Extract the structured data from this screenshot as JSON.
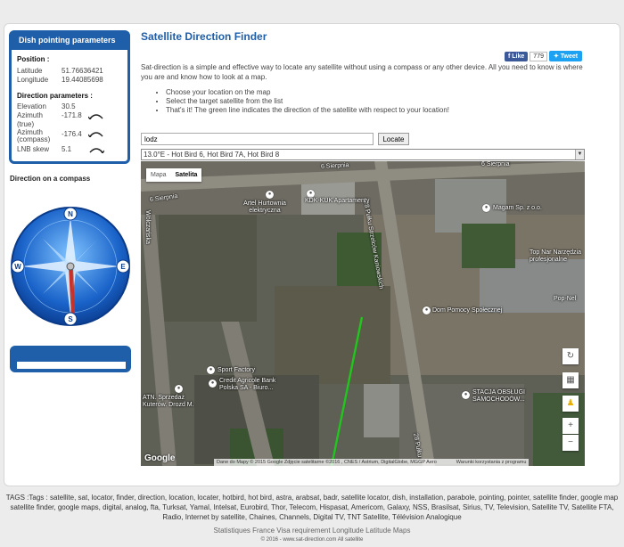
{
  "sidebar": {
    "panel_title": "Dish pointing parameters",
    "position_title": "Position :",
    "latitude_label": "Latitude",
    "latitude_value": "51.76636421",
    "longitude_label": "Longitude",
    "longitude_value": "19.44085698",
    "direction_title": "Direction parameters :",
    "elevation_label": "Elevation",
    "elevation_value": "30.5",
    "azimuth_true_label": "Azimuth (true)",
    "azimuth_true_value": "-171.8",
    "azimuth_compass_label": "Azimuth (compass)",
    "azimuth_compass_value": "-176.4",
    "lnb_label": "LNB skew",
    "lnb_value": "5.1",
    "compass_title": "Direction on a compass",
    "compass_n": "N",
    "compass_e": "E",
    "compass_s": "S",
    "compass_w": "W"
  },
  "main": {
    "title": "Satellite Direction Finder",
    "fb_like": "Like",
    "fb_count": "779",
    "tweet": "Tweet",
    "intro": "Sat-direction is a simple and effective way to locate any satellite without using a compass or any other device. All you need to know is where you are and know how to look at a map.",
    "steps": [
      "Choose your location on the map",
      "Select the target satellite from the list",
      "That's it! The green line indicates the direction of the satellite with respect to your location!"
    ],
    "search_value": "lodz",
    "locate_label": "Locate",
    "satellite_selected": "13.0°E - Hot Bird 6, Hot Bird 7A, Hot Bird 8"
  },
  "map": {
    "tab_map": "Mapa",
    "tab_satellite": "Satelita",
    "labels": {
      "street1": "6 Sierpnia",
      "street2": "6 Sierpnia",
      "street3": "6 Sierpnia",
      "street4": "28 Pułku Strzelców Kaniowskich",
      "street5": "28 Pułku",
      "street6": "Wólczańska",
      "poi1": "Artel Hurtownia elektryczna",
      "poi2": "KDK-KUK Apartamenty",
      "poi3": "Magam Sp. z o.o.",
      "poi4": "Top Nar Narzędzia profesjonalne",
      "poi5": "Dom Pomocy Społecznej",
      "poi6": "Pop-Nel",
      "poi7": "Sport Factory",
      "poi8": "Credit Agricole Bank Polska SA - Biuro...",
      "poi9": "ATN. Sprzedaż Kuterów. Drozd M.",
      "poi10": "STACJA OBSŁUGI SAMOCHODÓW..."
    },
    "google": "Google",
    "attribution": "Dane do Mapy © 2015 Google Zdjęcie satelitarne ©2016 , CNES / Astrium, DigitalGlobe, MGGP Aero",
    "terms": "Warunki korzystania z programu"
  },
  "footer": {
    "tags": "TAGS :Tags : satellite, sat, locator, finder, direction, location, locater, hotbird, hot bird, astra, arabsat, badr, satellite locator, dish, installation, parabole, pointing, pointer, satellite finder, google map satellite finder, google maps, digital, analog, fta, Turksat, Yamal, Intelsat, Eurobird, Thor, Telecom, Hispasat, Americom, Galaxy, NSS, Brasilsat, Sirius, TV, Television, Satellite TV, Satellite FTA, Radio, Internet by satellite, Chaines, Channels, Digital TV, TNT Satellite, Télévision Analogique",
    "link1": "Statistiques",
    "link2": "France Visa requirement",
    "link3": "Longitude Latitude",
    "link4": "Maps",
    "copyright": "© 2016 - www.sat-direction.com",
    "copyright_suffix": "All satellite"
  },
  "colors": {
    "accent": "#1f5ea8",
    "direction_line": "#22c51e",
    "needle_green": "#2e9a3a",
    "needle_red": "#c8312a"
  }
}
